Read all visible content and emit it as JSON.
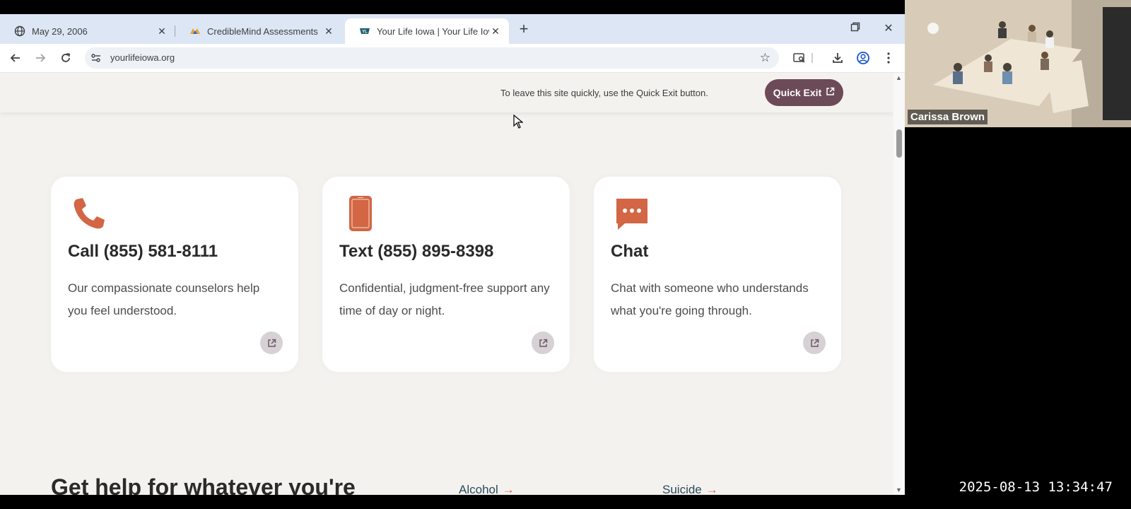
{
  "browser": {
    "tabs": [
      {
        "label": "May 29, 2006",
        "active": false,
        "icon": "globe-icon"
      },
      {
        "label": "CredibleMind Assessments",
        "active": false,
        "icon": "crediblemind-logo-icon"
      },
      {
        "label": "Your Life Iowa | Your Life Iowa",
        "active": true,
        "icon": "yourlifeiowa-logo-icon"
      }
    ],
    "new_tab_symbol": "+",
    "url": "yourlifeiowa.org"
  },
  "page": {
    "quick_exit_notice": "To leave this site quickly, use the Quick Exit button.",
    "quick_exit_label": "Quick Exit",
    "cards": [
      {
        "icon": "phone-icon",
        "title": "Call (855) 581-8111",
        "description": "Our compassionate counselors help you feel understood."
      },
      {
        "icon": "mobile-device-icon",
        "title": "Text (855) 895-8398",
        "description": "Confidential, judgment-free support any time of day or night."
      },
      {
        "icon": "chat-bubble-icon",
        "title": "Chat",
        "description": "Chat with someone who understands what you're going through."
      }
    ],
    "section_heading": "Get help for whatever you're",
    "topic_links": [
      {
        "label": "Alcohol",
        "arrow": "→"
      },
      {
        "label": "Suicide",
        "arrow": "→"
      }
    ]
  },
  "video_call": {
    "participant_name": "Carissa Brown"
  },
  "recording_timestamp": "2025-08-13 13:34:47",
  "colors": {
    "accent_orange": "#d26645",
    "quick_exit_bg": "#6c4a57",
    "page_bg": "#f4f2ee",
    "tabstrip_bg": "#dde6f5"
  }
}
